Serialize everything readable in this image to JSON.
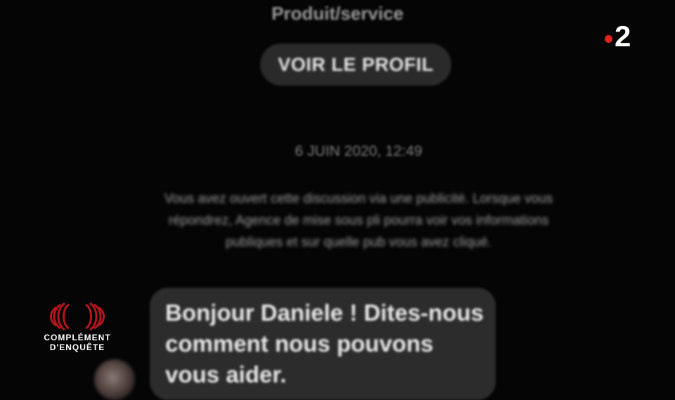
{
  "conversation": {
    "profile_subtitle": "Produit/service",
    "view_profile_label": "VOIR LE PROFIL",
    "timestamp": "6 JUIN 2020, 12:49",
    "ad_notice": "Vous avez ouvert cette discussion via une publicité. Lorsque vous répondrez, Agence de mise sous pli pourra voir vos informations publiques et sur quelle pub vous avez cliqué.",
    "message_text": "Bonjour Daniele ! Dites-nous comment nous pouvons vous aider."
  },
  "overlay": {
    "channel_label": "2",
    "channel_dot_color": "#e2231a",
    "show_title_line1": "COMPLÉMENT",
    "show_title_line2": "D'ENQUÊTE",
    "show_logo_color": "#b5151d"
  }
}
